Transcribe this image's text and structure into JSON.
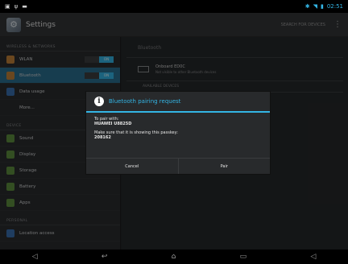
{
  "status_bar": {
    "left_icons": [
      "image-icon",
      "usb-icon",
      "notification-icon"
    ],
    "time": "02:51"
  },
  "action_bar": {
    "title": "Settings",
    "search_label": "SEARCH FOR DEVICES"
  },
  "sidebar": {
    "sections": [
      {
        "header": "WIRELESS & NETWORKS",
        "items": [
          {
            "label": "WLAN",
            "icon": "wifi-icon",
            "icon_color": "#c2813a",
            "toggle": "ON"
          },
          {
            "label": "Bluetooth",
            "icon": "bluetooth-icon",
            "icon_color": "#c2813a",
            "toggle": "ON",
            "active": true
          },
          {
            "label": "Data usage",
            "icon": "data-usage-icon",
            "icon_color": "#3a6fb0"
          },
          {
            "label": "More...",
            "icon": "",
            "icon_color": ""
          }
        ]
      },
      {
        "header": "DEVICE",
        "items": [
          {
            "label": "Sound",
            "icon": "sound-icon",
            "icon_color": "#5d8f3e"
          },
          {
            "label": "Display",
            "icon": "display-icon",
            "icon_color": "#5d8f3e"
          },
          {
            "label": "Storage",
            "icon": "storage-icon",
            "icon_color": "#5d8f3e"
          },
          {
            "label": "Battery",
            "icon": "battery-icon",
            "icon_color": "#5d8f3e"
          },
          {
            "label": "Apps",
            "icon": "apps-icon",
            "icon_color": "#5d8f3e"
          }
        ]
      },
      {
        "header": "PERSONAL",
        "items": [
          {
            "label": "Location access",
            "icon": "location-icon",
            "icon_color": "#3a6fb0"
          }
        ]
      }
    ]
  },
  "detail": {
    "header": "Bluetooth",
    "device_name": "Onboard ED0C",
    "device_sub": "Not visible to other Bluetooth devices",
    "available": "AVAILABLE DEVICES"
  },
  "dialog": {
    "title": "Bluetooth pairing request",
    "line1": "To pair with:",
    "device": "HUAWEI U8825D",
    "line2": "Make sure that it is showing this passkey:",
    "passkey": "208162",
    "cancel": "Cancel",
    "pair": "Pair"
  },
  "colors": {
    "accent": "#33b5e5",
    "active_item": "#2a6f90"
  }
}
